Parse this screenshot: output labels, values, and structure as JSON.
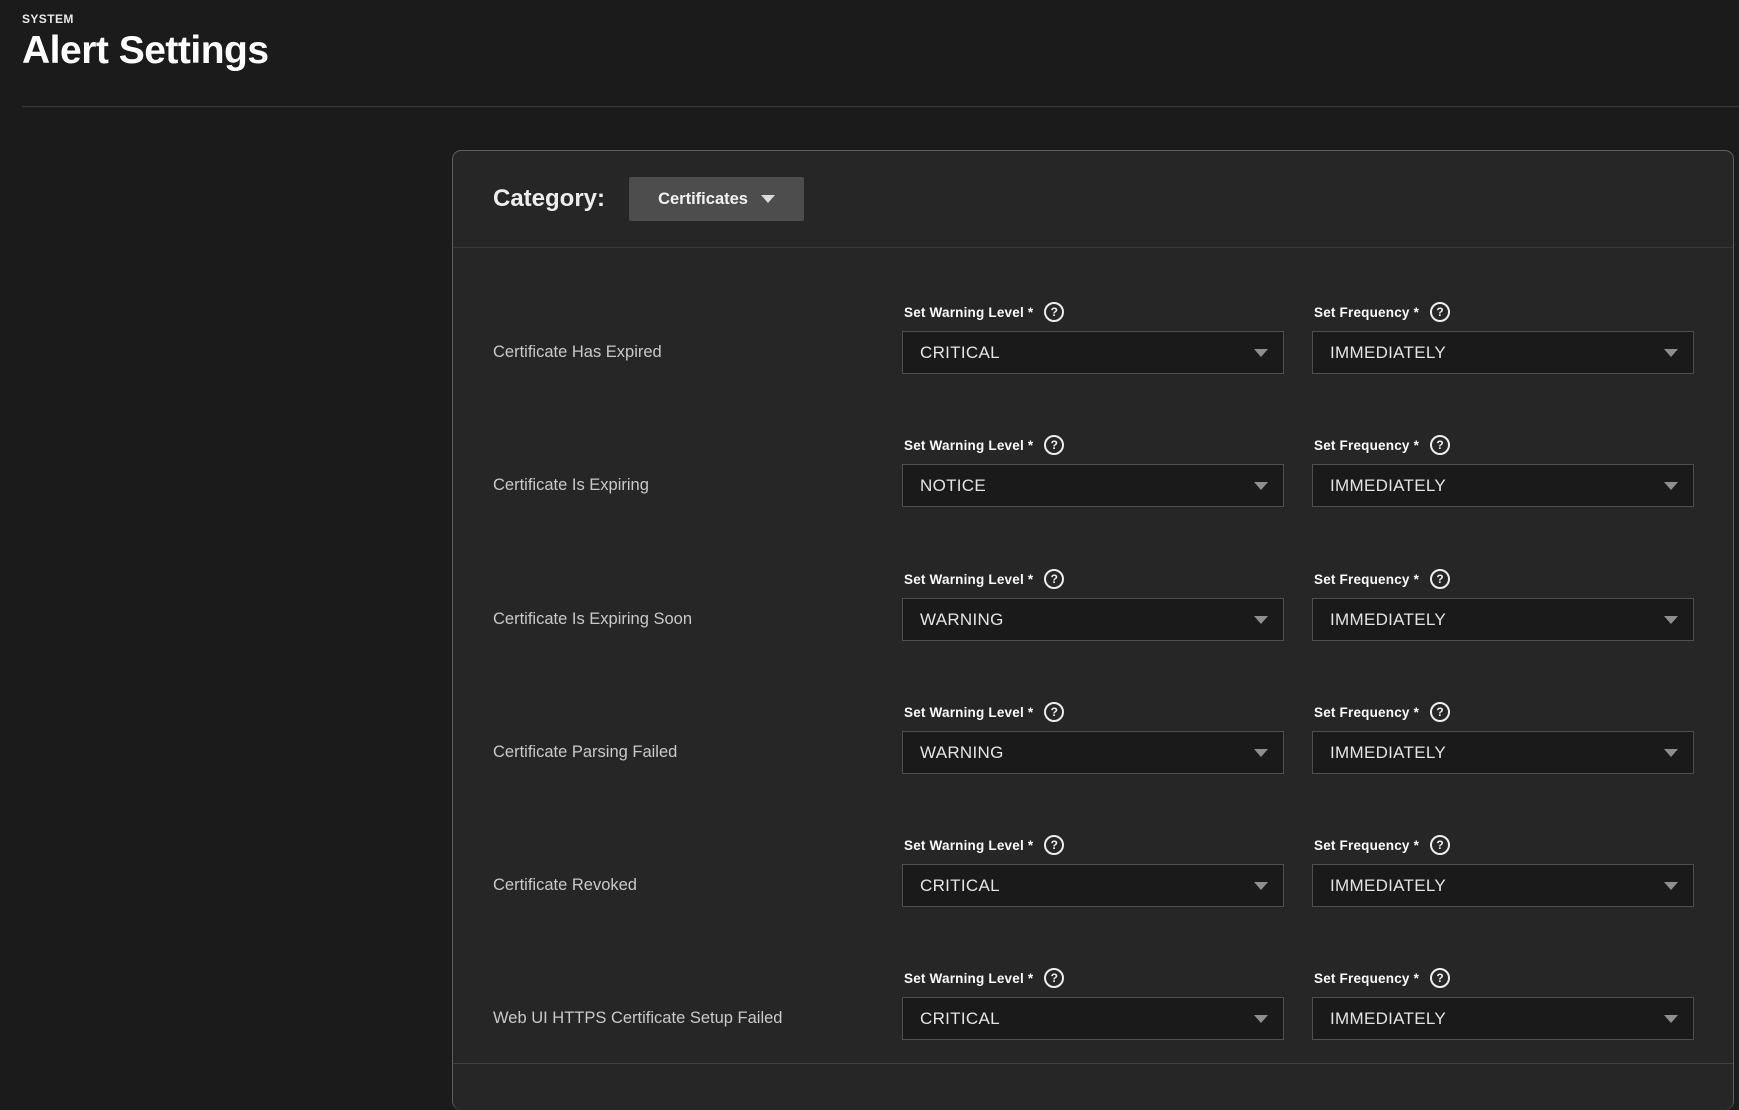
{
  "page": {
    "eyebrow": "SYSTEM",
    "title": "Alert Settings"
  },
  "category": {
    "label": "Category:",
    "selected": "Certificates"
  },
  "field_labels": {
    "warning": "Set Warning Level *",
    "frequency": "Set Frequency *"
  },
  "icons": {
    "help": "?"
  },
  "alerts": [
    {
      "name": "Certificate Has Expired",
      "warning_level": "CRITICAL",
      "frequency": "IMMEDIATELY"
    },
    {
      "name": "Certificate Is Expiring",
      "warning_level": "NOTICE",
      "frequency": "IMMEDIATELY"
    },
    {
      "name": "Certificate Is Expiring Soon",
      "warning_level": "WARNING",
      "frequency": "IMMEDIATELY"
    },
    {
      "name": "Certificate Parsing Failed",
      "warning_level": "WARNING",
      "frequency": "IMMEDIATELY"
    },
    {
      "name": "Certificate Revoked",
      "warning_level": "CRITICAL",
      "frequency": "IMMEDIATELY"
    },
    {
      "name": "Web UI HTTPS Certificate Setup Failed",
      "warning_level": "CRITICAL",
      "frequency": "IMMEDIATELY"
    }
  ],
  "colors": {
    "page_bg": "#1b1b1b",
    "card_bg": "#262626",
    "card_border": "#5e5e5e",
    "field_bg": "#1a1a1a",
    "field_border": "#4f4f4f",
    "button_bg": "#4d4d4d",
    "text_primary": "#ffffff",
    "text_secondary": "#c9c9c9"
  }
}
